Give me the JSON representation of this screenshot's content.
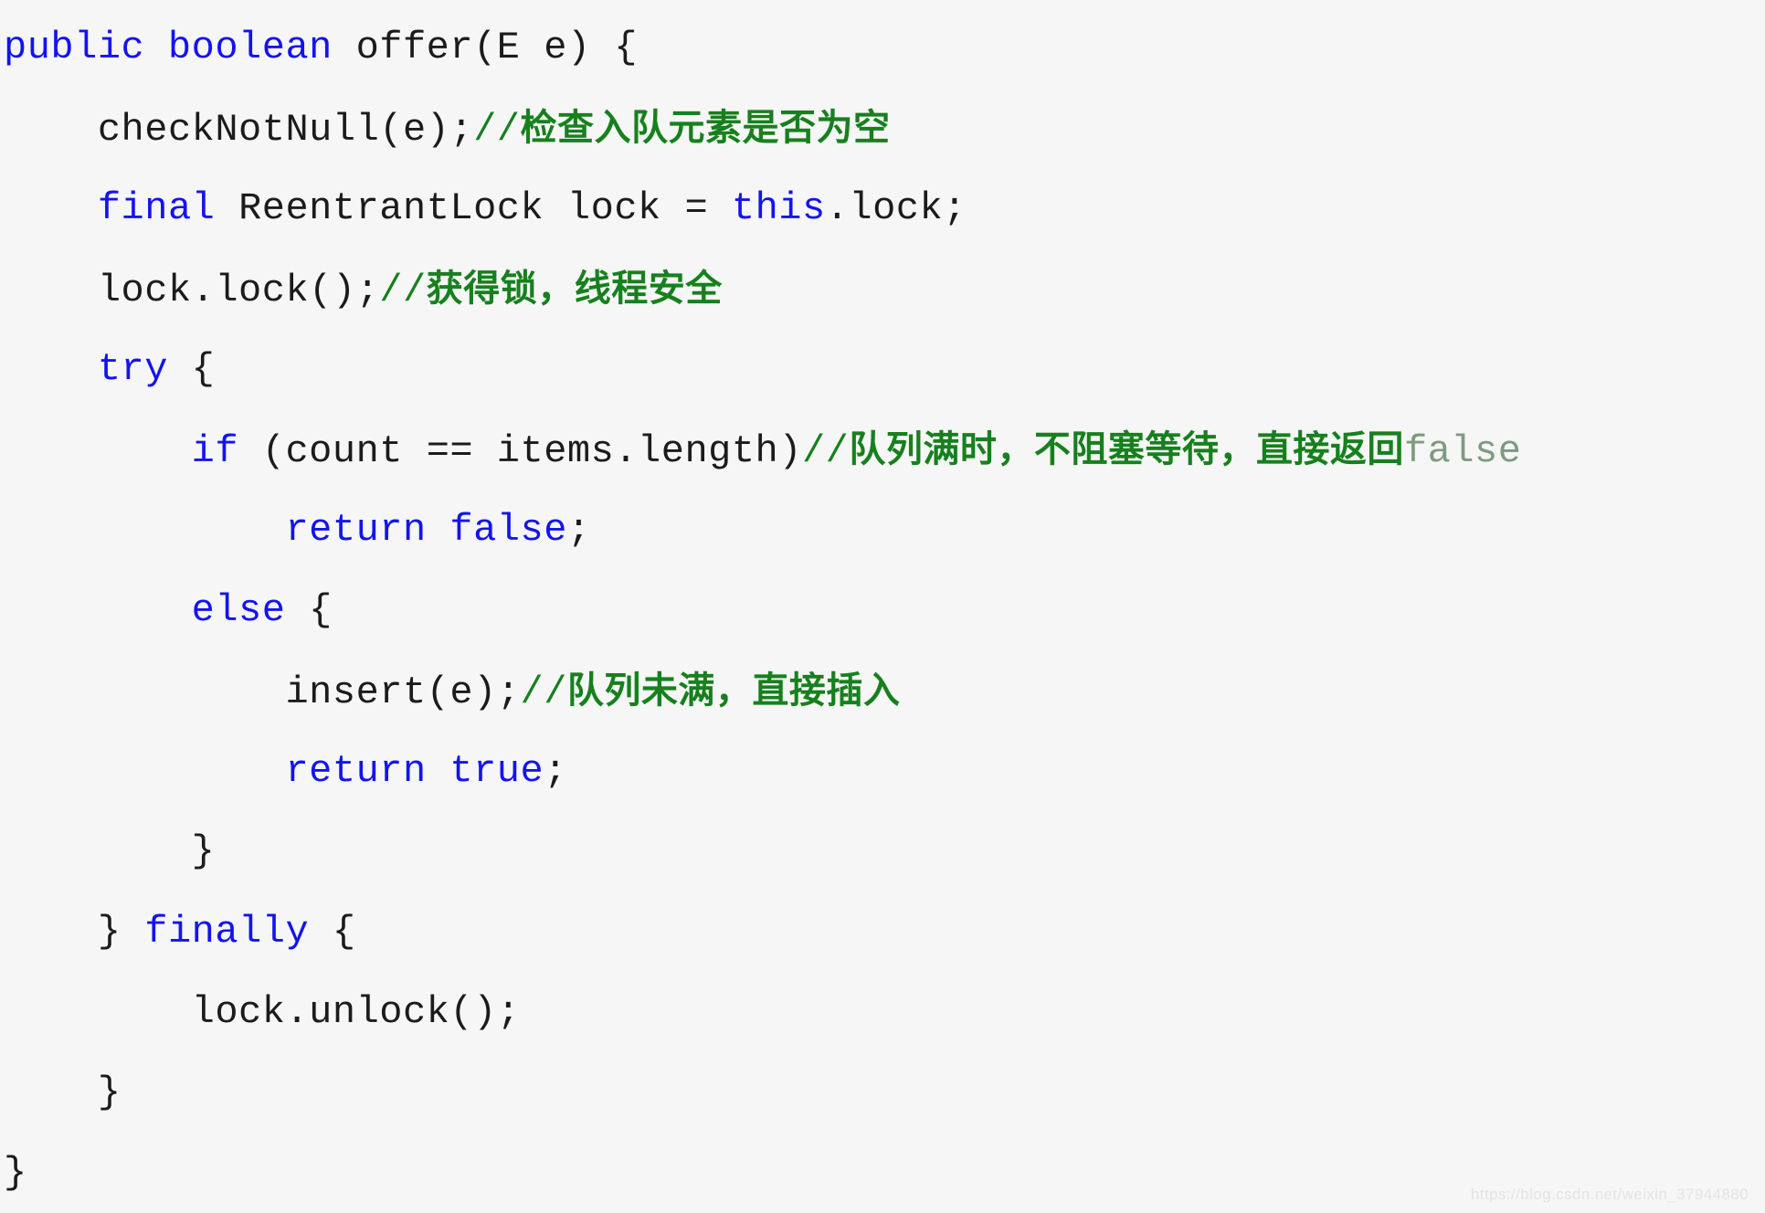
{
  "page": {
    "background_color": "#f5f6f5",
    "language": "java",
    "watermark": "https://blog.csdn.net/weixin_37944880"
  },
  "theme": {
    "keyword_color": "#1313f0",
    "plain_color": "#1b1b1b",
    "comment_color": "#17801e",
    "comment_dim_color": "#7f9a80",
    "watermark_color": "#e3e4e3"
  },
  "code": {
    "lines": [
      {
        "indent": 0,
        "text": "public boolean offer(E e) {",
        "tokens": [
          {
            "t": "public boolean",
            "k": "keyword"
          },
          {
            "t": " offer(E e) {",
            "k": "plain"
          }
        ]
      },
      {
        "indent": 1,
        "text": "checkNotNull(e);//检查入队元素是否为空",
        "tokens": [
          {
            "t": "checkNotNull(e);",
            "k": "plain"
          },
          {
            "t": "//",
            "k": "comment"
          },
          {
            "t": "检查入队元素是否为空",
            "k": "comment",
            "cjk": true
          }
        ]
      },
      {
        "indent": 1,
        "text": "final ReentrantLock lock = this.lock;",
        "tokens": [
          {
            "t": "final",
            "k": "keyword"
          },
          {
            "t": " ReentrantLock lock = ",
            "k": "plain"
          },
          {
            "t": "this",
            "k": "keyword"
          },
          {
            "t": ".lock;",
            "k": "plain"
          }
        ]
      },
      {
        "indent": 1,
        "text": "lock.lock();//获得锁，线程安全",
        "tokens": [
          {
            "t": "lock.lock();",
            "k": "plain"
          },
          {
            "t": "//",
            "k": "comment"
          },
          {
            "t": "获得锁，线程安全",
            "k": "comment",
            "cjk": true
          }
        ]
      },
      {
        "indent": 1,
        "text": "try {",
        "tokens": [
          {
            "t": "try",
            "k": "keyword"
          },
          {
            "t": " {",
            "k": "plain"
          }
        ]
      },
      {
        "indent": 2,
        "text": "if (count == items.length)//队列满时，不阻塞等待，直接返回false",
        "tokens": [
          {
            "t": "if",
            "k": "keyword"
          },
          {
            "t": " (count == items.length)",
            "k": "plain"
          },
          {
            "t": "//",
            "k": "comment"
          },
          {
            "t": "队列满时，不阻塞等待，直接返回",
            "k": "comment",
            "cjk": true
          },
          {
            "t": "false",
            "k": "comment-dim"
          }
        ]
      },
      {
        "indent": 3,
        "text": "return false;",
        "tokens": [
          {
            "t": "return false",
            "k": "keyword"
          },
          {
            "t": ";",
            "k": "plain"
          }
        ]
      },
      {
        "indent": 2,
        "text": "else {",
        "tokens": [
          {
            "t": "else",
            "k": "keyword"
          },
          {
            "t": " {",
            "k": "plain"
          }
        ]
      },
      {
        "indent": 3,
        "text": "insert(e);//队列未满，直接插入",
        "tokens": [
          {
            "t": "insert(e);",
            "k": "plain"
          },
          {
            "t": "//",
            "k": "comment"
          },
          {
            "t": "队列未满，直接插入",
            "k": "comment",
            "cjk": true
          }
        ]
      },
      {
        "indent": 3,
        "text": "return true;",
        "tokens": [
          {
            "t": "return true",
            "k": "keyword"
          },
          {
            "t": ";",
            "k": "plain"
          }
        ]
      },
      {
        "indent": 2,
        "text": "}",
        "tokens": [
          {
            "t": "}",
            "k": "plain"
          }
        ]
      },
      {
        "indent": 1,
        "text": "} finally {",
        "tokens": [
          {
            "t": "} ",
            "k": "plain"
          },
          {
            "t": "finally",
            "k": "keyword"
          },
          {
            "t": " {",
            "k": "plain"
          }
        ]
      },
      {
        "indent": 2,
        "text": "lock.unlock();",
        "tokens": [
          {
            "t": "lock.unlock();",
            "k": "plain"
          }
        ]
      },
      {
        "indent": 1,
        "text": "}",
        "tokens": [
          {
            "t": "}",
            "k": "plain"
          }
        ]
      },
      {
        "indent": 0,
        "text": "}",
        "tokens": [
          {
            "t": "}",
            "k": "plain"
          }
        ]
      }
    ]
  }
}
